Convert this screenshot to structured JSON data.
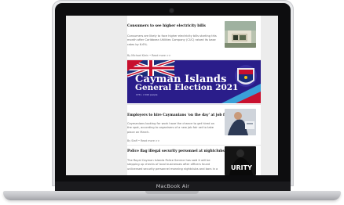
{
  "device": {
    "brand_label": "MacBook Air"
  },
  "articles": [
    {
      "headline": "Consumers to see higher electricity bills",
      "excerpt": "Consumers are likely to face higher electricity bills starting this month after Caribbean Utilities Company (CUC) raised its base rates by 6.6%.",
      "byline": "By Michael Klein • Read more >>"
    },
    {
      "headline": "Employers to hire Caymanians 'on the day' at job fair",
      "excerpt": "Caymanians looking for work have the chance to get hired on the spot, according to organisers of a new job fair set to take place on March.",
      "byline": "By Staff • Read more >>"
    },
    {
      "headline": "Police flag illegal security personnel at nightclubs",
      "excerpt": "The Royal Cayman Islands Police Service has said it will be stepping up checks of local businesses after officers found unlicensed security personnel manning nightclubs and bars in a",
      "byline": ""
    }
  ],
  "banner": {
    "title_line1": "Cayman Islands",
    "title_line2": "General Election 2021",
    "subtitle": "CYN • 2 024 people"
  },
  "colors": {
    "banner_bg": "#2a1d8a",
    "screen_bg": "#ececec"
  }
}
